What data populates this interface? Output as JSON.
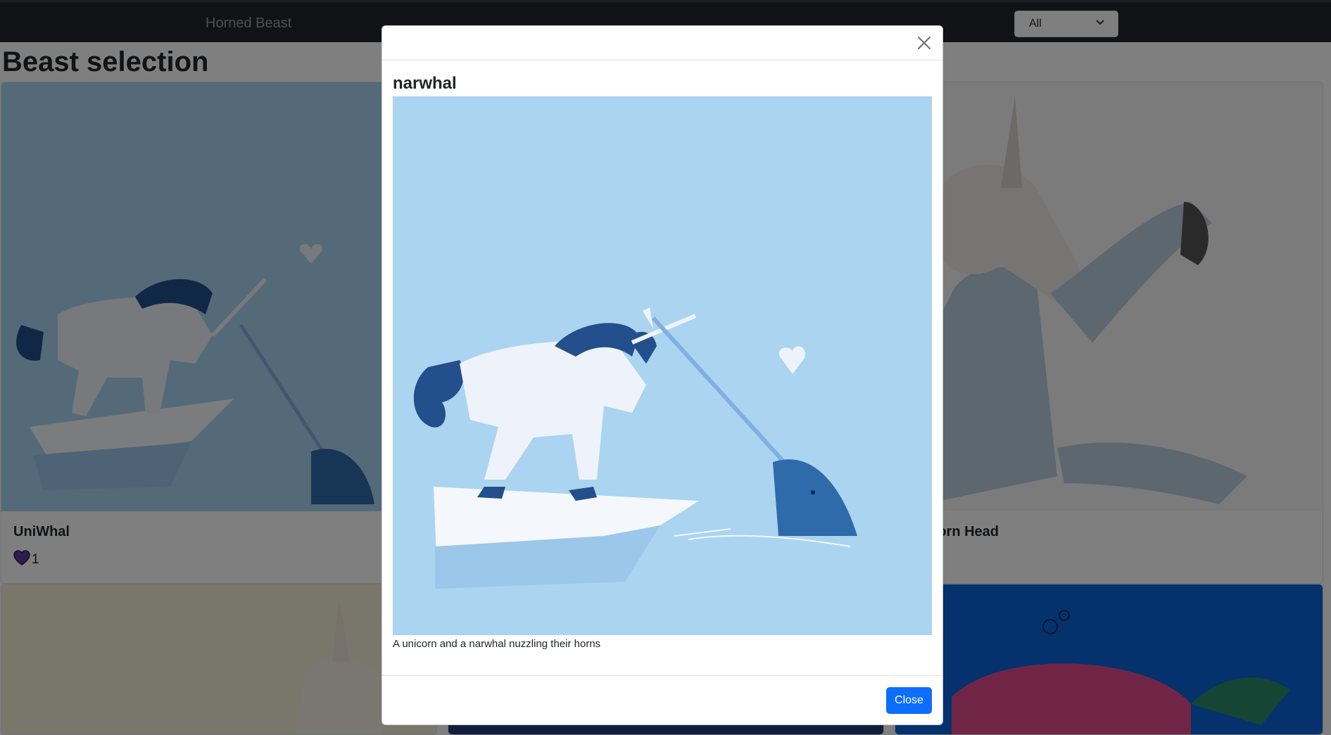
{
  "navbar": {
    "brand": "Horned Beast",
    "filter": {
      "selected": "All"
    }
  },
  "page": {
    "title": "Beast selection"
  },
  "cards": [
    {
      "title": "UniWhal",
      "likes": "1"
    },
    {
      "title": "Unicorn Head"
    }
  ],
  "modal": {
    "title": "narwhal",
    "caption": "A unicorn and a narwhal nuzzling their horns",
    "close_label": "Close"
  },
  "colors": {
    "navbar": "#212529",
    "primary": "#0d6efd",
    "illustration_bg": "#abd4f0",
    "heart": "#5b3a98"
  },
  "icons": [
    "close-icon",
    "chevron-down-icon",
    "heart-icon"
  ]
}
